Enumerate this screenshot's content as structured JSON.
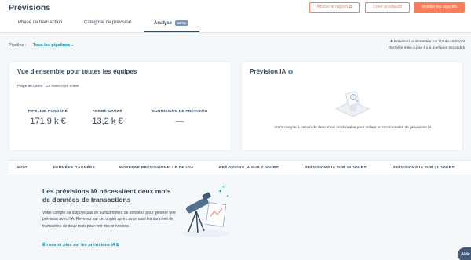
{
  "header": {
    "title": "Prévisions",
    "buttons": {
      "report": "Afficher le rapport",
      "create_goal": "Créer un objectif",
      "edit_goals": "Modifier les objectifs"
    }
  },
  "tabs": [
    {
      "label": "Phase de transaction"
    },
    {
      "label": "Catégorie de prévision"
    },
    {
      "label": "Analyse",
      "badge": "BÊTA",
      "active": true
    }
  ],
  "filters": {
    "pipeline_label": "Pipeline :",
    "pipeline_value": "Tous les pipelines"
  },
  "ai_note": {
    "line1": "Prévision IA alimentée par l'IA de HubSpot",
    "line2": "Dernière mise à jour il y a quelques secondes"
  },
  "overview_card": {
    "title": "Vue d'ensemble pour toutes les équipes",
    "date_range": "Plage de dates : Ce mois-ci en entier",
    "kpis": [
      {
        "label": "PIPELINE PONDÉRÉ",
        "value": "171,9 k €"
      },
      {
        "label": "FERMÉ GAGNÉ",
        "value": "13,2 k €"
      },
      {
        "label": "SOUMISSION DE PRÉVISION",
        "value": "—"
      }
    ]
  },
  "ai_card": {
    "title": "Prévision IA",
    "message": "Votre compte a besoin de deux mois de données pour utiliser la fonctionnalité de prévisions IA"
  },
  "table": {
    "columns": [
      "MOIS",
      "FERMÉES GAGNÉES",
      "MOYENNE PRÉVISIONNELLE DE L'IA",
      "PRÉVISIONS IA SUR 7 JOURS",
      "PRÉVISIONS IA SUR 14 JOURS",
      "PRÉVISIONS IA SUR 21 JOURS"
    ]
  },
  "empty_state": {
    "title": "Les prévisions IA nécessitent deux mois de données de transactions",
    "body": "Votre compte ne dispose pas de suffisamment de données pour générer une prévision avec l'IA. Revenez sur cet onglet après avoir saisi les données de transaction de deux mois pour voir des prévisions.",
    "link": "En savoir plus sur les prévisions IA"
  },
  "help": {
    "label": "Aide"
  },
  "colors": {
    "accent": "#ff7a59",
    "link": "#0091ae",
    "text": "#33475b",
    "background": "#f5f8fa"
  }
}
